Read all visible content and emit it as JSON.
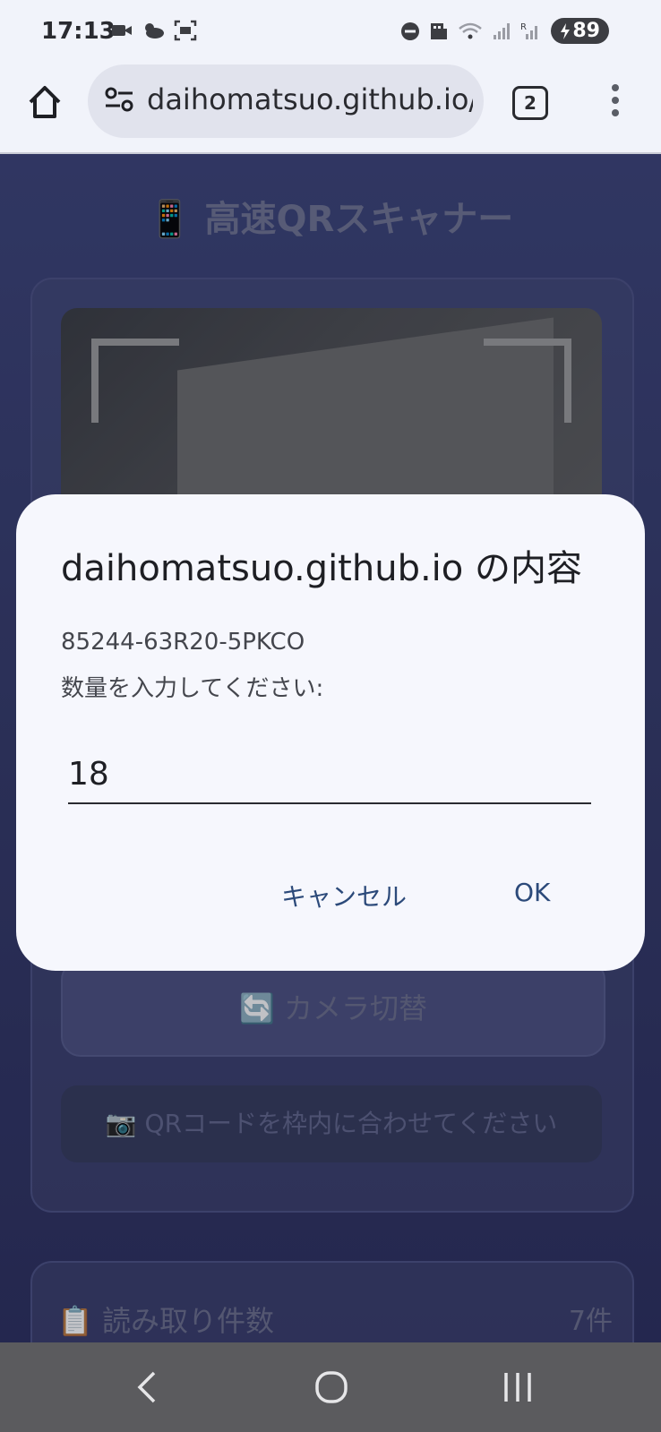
{
  "status_bar": {
    "time": "17:13",
    "battery": "89",
    "icons_left": [
      "video-icon",
      "weather-icon",
      "screenshot-icon"
    ],
    "icons_right": [
      "dnd-icon",
      "building-icon",
      "wifi-icon",
      "signal-icon",
      "signal-r-icon"
    ]
  },
  "browser": {
    "url": "daihomatsuo.github.io/q",
    "tab_count": "2"
  },
  "page": {
    "title": "📱 高速QRスキャナー",
    "switch_camera": "🔄 カメラ切替",
    "hint": "📷 QRコードを枠内に合わせてください",
    "count_label": "📋 読み取り件数",
    "count_value": "7件"
  },
  "dialog": {
    "title": "daihomatsuo.github.io の内容",
    "code": "85244-63R20-5PKCO",
    "message": "数量を入力してください:",
    "input_value": "18",
    "cancel_label": "キャンセル",
    "ok_label": "OK"
  },
  "colors": {
    "page_bg": "#2a2f63",
    "dialog_bg": "#f6f7fd",
    "button_text": "#2c4a7a"
  }
}
